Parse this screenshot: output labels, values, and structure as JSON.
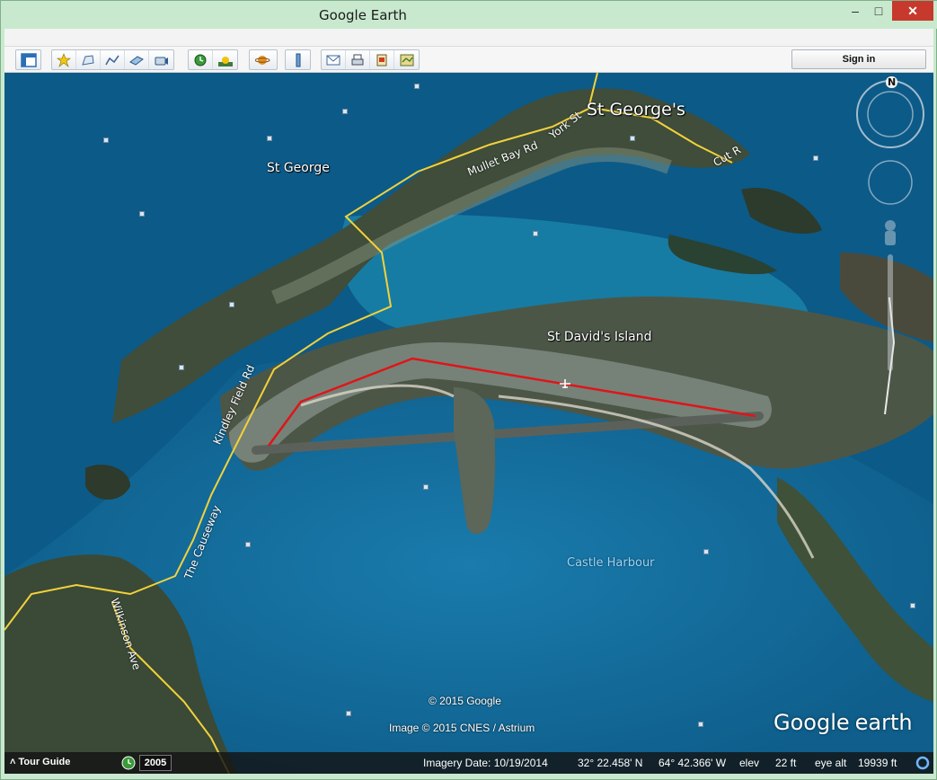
{
  "window": {
    "title": "Google Earth",
    "controls": {
      "minimize": "–",
      "maximize": "□",
      "close": "✕"
    }
  },
  "toolbar": {
    "sign_in_label": "Sign in",
    "buttons": [
      "sidebar-toggle",
      "add-placemark",
      "add-polygon",
      "add-path",
      "add-image-overlay",
      "record-tour",
      "historical-imagery",
      "sunlight",
      "planets",
      "ruler",
      "email",
      "print",
      "save-image",
      "view-in-maps"
    ]
  },
  "map": {
    "place_labels": {
      "st_georges": "St George's",
      "st_george": "St George",
      "st_davids_island": "St David's Island"
    },
    "road_labels": {
      "york_st": "York St",
      "mullet_bay_rd": "Mullet Bay Rd",
      "cut_rd": "Cut R",
      "kindley_field_rd": "Kindley Field Rd",
      "the_causeway": "The Causeway",
      "wilkinson_ave": "Wilkinson Ave"
    },
    "water_labels": {
      "castle_harbour": "Castle Harbour"
    },
    "compass_north": "N",
    "copyright_google": "© 2015 Google",
    "copyright_image": "Image © 2015 CNES / Astrium",
    "logo_google": "Google",
    "logo_earth": "earth",
    "path_color": "#e0141a"
  },
  "status": {
    "tour_guide": "Tour Guide",
    "year": "2005",
    "imagery_date": "Imagery Date: 10/19/2014",
    "latitude": "32° 22.458' N",
    "longitude": "64° 42.366' W",
    "elev_label": "elev",
    "elev_value": "22 ft",
    "eye_alt_label": "eye alt",
    "eye_alt_value": "19939 ft"
  }
}
